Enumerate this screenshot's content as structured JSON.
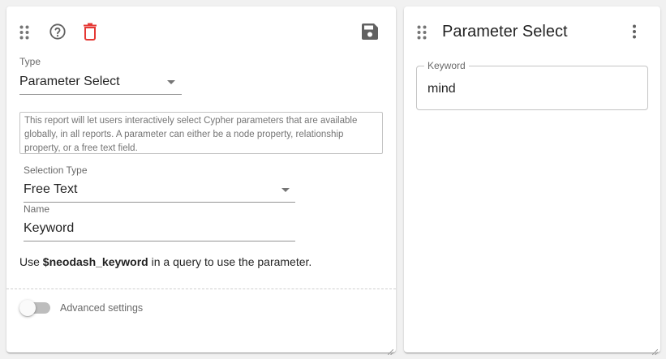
{
  "left_card": {
    "type_field": {
      "label": "Type",
      "value": "Parameter Select"
    },
    "description": "This report will let users interactively select Cypher parameters that are available globally, in all reports. A parameter can either be a node property, relationship property, or a free text field.",
    "selection_type_field": {
      "label": "Selection Type",
      "value": "Free Text"
    },
    "name_field": {
      "label": "Name",
      "value": "Keyword"
    },
    "help_text": {
      "prefix": "Use ",
      "param": "$neodash_keyword",
      "suffix": " in a query to use the parameter."
    },
    "advanced_settings": {
      "label": "Advanced settings",
      "enabled": false
    },
    "icons": {
      "drag": "drag-indicator-icon",
      "help": "help-outline-icon",
      "delete": "delete-icon",
      "save": "save-icon"
    },
    "colors": {
      "delete_icon": "#e53935",
      "icon_gray": "#757575"
    }
  },
  "right_card": {
    "title": "Parameter Select",
    "keyword_field": {
      "label": "Keyword",
      "value": "mind"
    },
    "icons": {
      "drag": "drag-indicator-icon",
      "menu": "more-vert-icon"
    }
  }
}
